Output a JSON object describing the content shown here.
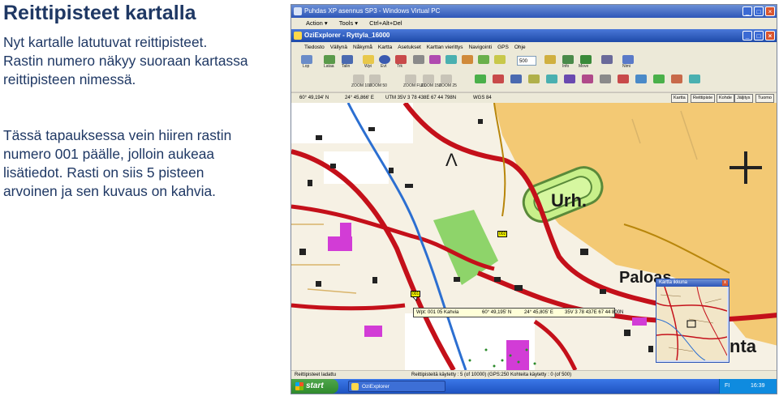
{
  "slide": {
    "title": "Reittipisteet kartalla",
    "paragraph1": [
      "Nyt kartalle latutuvat reittipisteet.",
      "Rastin numero näkyy suoraan kartassa",
      "reittipisteen nimessä."
    ],
    "paragraph2": [
      "Tässä tapauksessa vein hiiren rastin",
      "numero 001 päälle, jolloin aukeaa",
      "lisätiedot. Rasti on siis 5 pisteen",
      "arvoinen ja sen kuvaus on kahvia."
    ]
  },
  "vpc_window": {
    "title": "Puhdas XP asennus SP3 - Windows Virtual PC",
    "menu": [
      "Action ▾",
      "Tools ▾",
      "Ctrl+Alt+Del"
    ]
  },
  "app": {
    "title": "OziExplorer - Ryttyla_16000",
    "menu": [
      "Tiedosto",
      "Vällynä",
      "Nåkymå",
      "Kartta",
      "Asetukset",
      "Karttan vierittys",
      "Navigointi",
      "GPS",
      "Ohje"
    ],
    "toolbar1_labels": [
      "Lop",
      "Lataa",
      "Talin",
      "Wpt",
      "Evt",
      "Trk",
      "Fnt",
      "Info",
      "Move",
      "Nimi"
    ],
    "zoom_value": "500",
    "toolbar2_labels": [
      "ZOOM 100",
      "ZOOM 50",
      "ZOOM FULL",
      "ZOOM 150",
      "ZOOM 25"
    ]
  },
  "coord_bar": {
    "lat": "60° 49,194' N",
    "lon": "24° 45,866' E",
    "utm": "UTM  35V    3 78 438E  67 44 798N",
    "datum": "WGS 84",
    "mode_buttons": [
      "Kartta",
      "Reittipiste",
      "Kohde",
      "Jäljitys",
      "Tuomo"
    ]
  },
  "map": {
    "place_labels": [
      "Urh.",
      "Paloas",
      "nta"
    ],
    "waypoint_labels": [
      "001",
      "002"
    ]
  },
  "waypoint_info": {
    "name": "Wpt: 001  05  Kahvia",
    "lat": "60° 49,195' N",
    "lon": "24° 45,805' E",
    "utm": "35V   3 78 437E  67 44 800N"
  },
  "mini_map": {
    "title": "Kartta ikkuna",
    "close": "x"
  },
  "status": {
    "left": "Reittipisteet ladattu",
    "mid": "Reittipisteitä käytetty : 5 (of 10000)  (GPS:250  Kohteita käytetty : 0 (of 500)"
  },
  "taskbar": {
    "start": "start",
    "task": "OziExplorer",
    "lang": "FI",
    "time": "16:39"
  },
  "colors": {
    "road_red": "#c4101a",
    "river_blue": "#2c6fd1",
    "magenta_building": "#d23cd6",
    "green_field": "#8ed46a",
    "xp_blue": "#2d56b8"
  }
}
